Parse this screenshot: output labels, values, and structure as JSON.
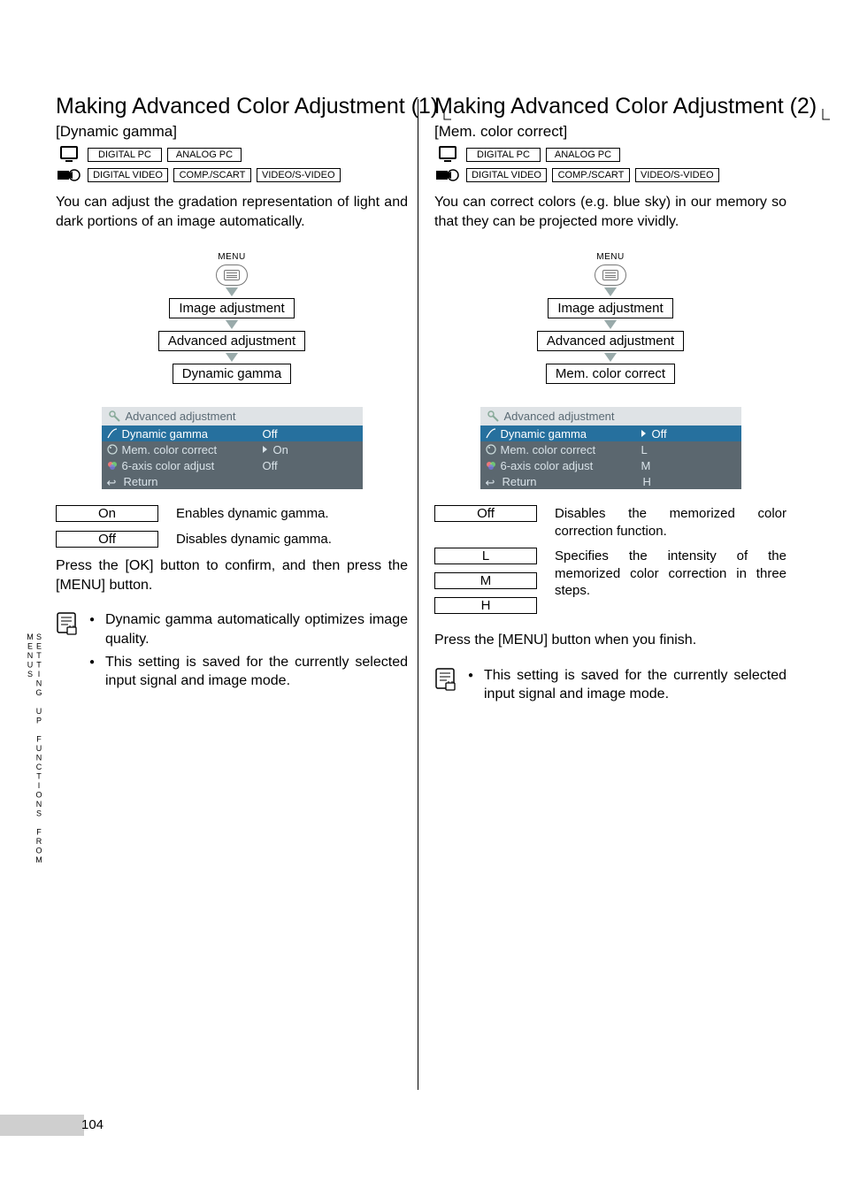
{
  "page_number": "104",
  "side_label": "SETTING UP FUNCTIONS FROM MENUS",
  "sources": {
    "pc1": "DIGITAL PC",
    "pc2": "ANALOG PC",
    "vid1": "DIGITAL VIDEO",
    "vid2": "COMP./SCART",
    "vid3": "VIDEO/S-VIDEO"
  },
  "menu_label": "MENU",
  "nav1": "Image adjustment",
  "nav2": "Advanced adjustment",
  "osd_title": "Advanced adjustment",
  "osd_items": {
    "dyn": "Dynamic gamma",
    "mem": "Mem. color correct",
    "six": "6-axis color adjust",
    "ret": "Return"
  },
  "left": {
    "title": "Making Advanced Color Adjustment (1)",
    "sub": "[Dynamic gamma]",
    "intro": "You can adjust the gradation representation of light and dark portions of an image automatically.",
    "nav3": "Dynamic gamma",
    "osd_vals": {
      "dyn": "Off",
      "mem": "On",
      "six": "Off"
    },
    "opt_on": "On",
    "opt_on_desc": "Enables dynamic gamma.",
    "opt_off": "Off",
    "opt_off_desc": "Disables dynamic gamma.",
    "confirm": "Press the [OK] button to confirm, and then press the [MENU] button.",
    "notes": [
      "Dynamic gamma automatically optimizes image quality.",
      "This setting is saved for the currently selected input signal and image mode."
    ]
  },
  "right": {
    "title": "Making Advanced Color Adjustment (2)",
    "sub": "[Mem. color correct]",
    "intro": "You can correct colors (e.g. blue sky) in our memory so that they can be projected more vividly.",
    "nav3": "Mem. color correct",
    "osd_vals": {
      "dyn": "Off",
      "mem": "L",
      "six": "M",
      "ret": "H"
    },
    "opt_off": "Off",
    "opt_off_desc": "Disables the memorized color correction function.",
    "opt_l": "L",
    "opt_l_desc": "Specifies the intensity of the memorized color correction in three steps.",
    "opt_m": "M",
    "opt_h": "H",
    "confirm": "Press the [MENU] button when you finish.",
    "notes": [
      "This setting is saved for the currently selected input signal and image mode."
    ]
  }
}
